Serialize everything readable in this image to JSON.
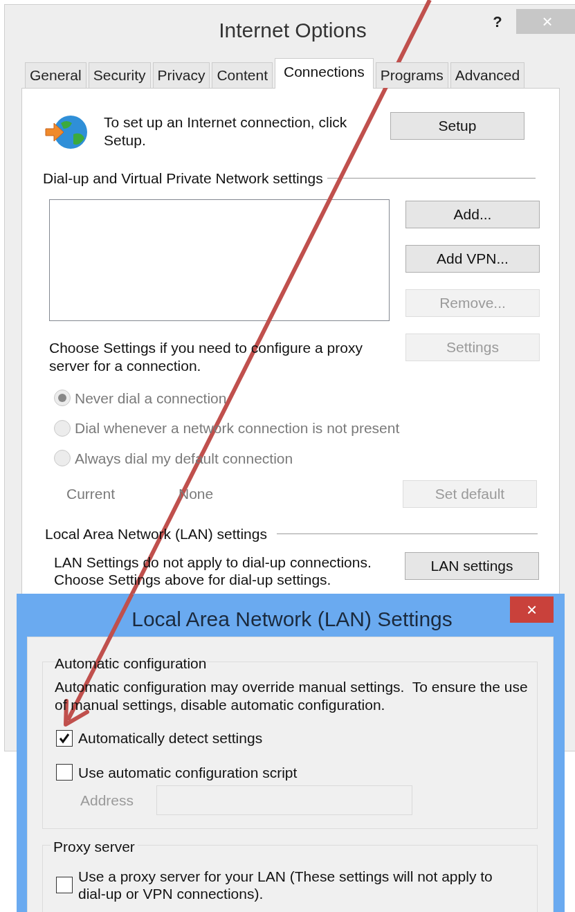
{
  "internet_options": {
    "title": "Internet Options",
    "help": "?",
    "close": "×",
    "tabs": [
      {
        "label": "General",
        "selected": false
      },
      {
        "label": "Security",
        "selected": false
      },
      {
        "label": "Privacy",
        "selected": false
      },
      {
        "label": "Content",
        "selected": false
      },
      {
        "label": "Connections",
        "selected": true
      },
      {
        "label": "Programs",
        "selected": false
      },
      {
        "label": "Advanced",
        "selected": false
      }
    ],
    "setup_text": "To set up an Internet connection, click Setup.",
    "setup_button": "Setup",
    "dialup_group": "Dial-up and Virtual Private Network settings",
    "dialup_buttons": [
      {
        "label": "Add...",
        "disabled": false
      },
      {
        "label": "Add VPN...",
        "disabled": false
      },
      {
        "label": "Remove...",
        "disabled": true
      },
      {
        "label": "Settings",
        "disabled": true
      }
    ],
    "proxy_hint": "Choose Settings if you need to configure a proxy server for a connection.",
    "dial_options": [
      {
        "label": "Never dial a connection",
        "selected": true,
        "disabled": true
      },
      {
        "label": "Dial whenever a network connection is not present",
        "selected": false,
        "disabled": true
      },
      {
        "label": "Always dial my default connection",
        "selected": false,
        "disabled": true
      }
    ],
    "current_label": "Current",
    "current_value": "None",
    "set_default": {
      "label": "Set default",
      "disabled": true
    },
    "lan_group": "Local Area Network (LAN) settings",
    "lan_text": "LAN Settings do not apply to dial-up connections. Choose Settings above for dial-up settings.",
    "lan_button": {
      "label": "LAN settings",
      "disabled": false
    }
  },
  "lan_dialog": {
    "title": "Local Area Network (LAN) Settings",
    "close": "×",
    "auto_group": "Automatic configuration",
    "auto_text": "Automatic configuration may override manual settings.  To ensure the use of manual settings, disable automatic configuration.",
    "auto_options": [
      {
        "label": "Automatically detect settings",
        "checked": true
      },
      {
        "label": "Use automatic configuration script",
        "checked": false
      }
    ],
    "address": {
      "label": "Address",
      "disabled": true
    },
    "proxy_group": "Proxy server",
    "proxy_option": {
      "label": "Use a proxy server for your LAN (These settings will not apply to dial-up or VPN connections).",
      "checked": false
    }
  }
}
